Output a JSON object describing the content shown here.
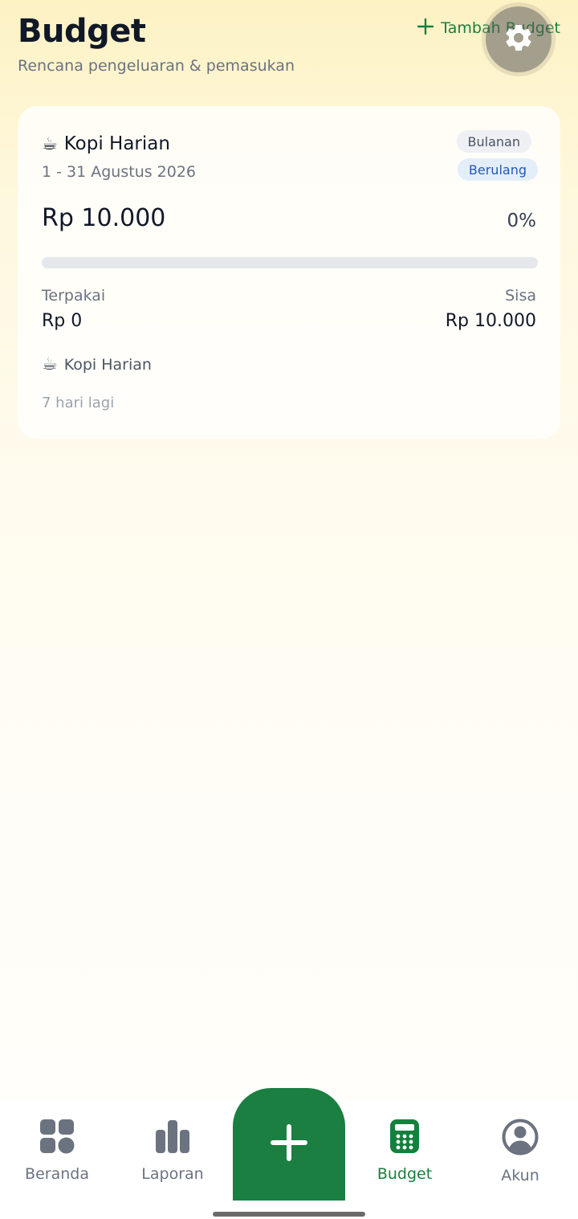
{
  "header": {
    "title": "Budget",
    "subtitle": "Rencana pengeluaran & pemasukan",
    "add_label": "Tambah Budget",
    "add_icon": "plus-icon",
    "settings_icon": "gear-icon"
  },
  "budget_card": {
    "emoji": "☕",
    "title": "Kopi Harian",
    "period": "1 - 31 Agustus 2026",
    "badge_period": "Bulanan",
    "badge_recurring": "Berulang",
    "amount": "Rp 10.000",
    "percent": "0%",
    "progress_fraction": 0,
    "used_label": "Terpakai",
    "used_value": "Rp 0",
    "remaining_label": "Sisa",
    "remaining_value": "Rp 10.000",
    "category_emoji": "☕",
    "category": "Kopi Harian",
    "days_left": "7 hari lagi"
  },
  "nav": {
    "items": [
      {
        "label": "Beranda",
        "icon": "grid-icon"
      },
      {
        "label": "Laporan",
        "icon": "bar-chart-icon"
      },
      {
        "label": "",
        "icon": "plus-icon"
      },
      {
        "label": "Budget",
        "icon": "calculator-icon"
      },
      {
        "label": "Akun",
        "icon": "user-icon"
      }
    ],
    "active": "Budget"
  },
  "colors": {
    "accent": "#15803d",
    "center_button": "#1a7f40",
    "inactive": "#6b7280"
  }
}
